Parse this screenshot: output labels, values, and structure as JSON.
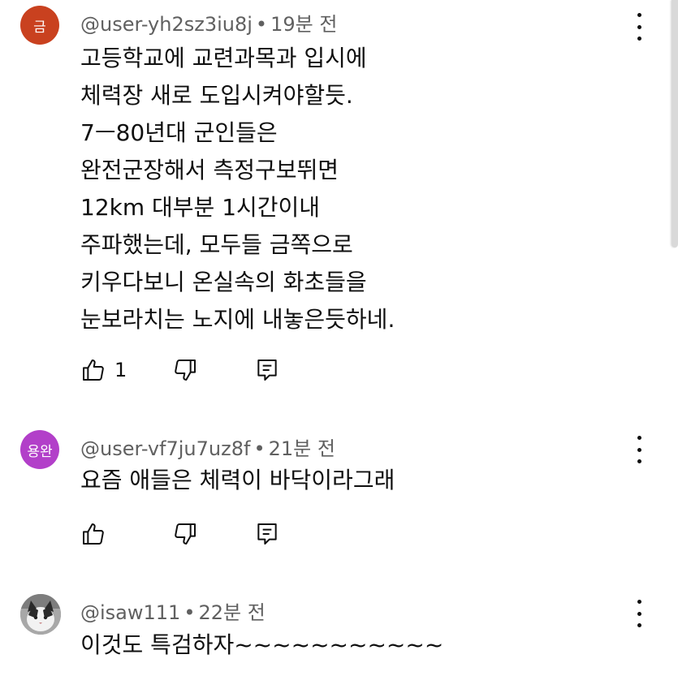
{
  "comments": [
    {
      "avatar_text": "금",
      "avatar_color": "#c9411f",
      "author": "@user-yh2sz3iu8j",
      "time": "19분 전",
      "lines": [
        "고등학교에 교련과목과 입시에",
        "체력장 새로 도입시켜야할듯.",
        "7ㅡ80년대 군인들은",
        "완전군장해서 측정구보뛰면",
        "12km 대부분 1시간이내",
        "주파했는데, 모두들 금쪽으로",
        "키우다보니 온실속의 화초들을",
        "눈보라치는 노지에 내놓은듯하네."
      ],
      "like_count": "1",
      "icons": {
        "like": "thumbs-up-icon",
        "dislike": "thumbs-down-icon",
        "reply": "reply-icon",
        "menu": "more-vert-icon"
      }
    },
    {
      "avatar_text": "용완",
      "avatar_color": "#b23fc9",
      "author": "@user-vf7ju7uz8f",
      "time": "21분 전",
      "lines": [
        "요즘 애들은 체력이 바닥이라그래"
      ],
      "like_count": "",
      "icons": {
        "like": "thumbs-up-icon",
        "dislike": "thumbs-down-icon",
        "reply": "reply-icon",
        "menu": "more-vert-icon"
      }
    },
    {
      "avatar_text": "",
      "avatar_color": "#8a8a8a",
      "author": "@isaw111",
      "time": "22분 전",
      "lines": [
        "이것도 특검하자~~~~~~~~~~~"
      ],
      "like_count": "",
      "icons": {
        "like": "thumbs-up-icon",
        "dislike": "thumbs-down-icon",
        "reply": "reply-icon",
        "menu": "more-vert-icon"
      }
    }
  ]
}
